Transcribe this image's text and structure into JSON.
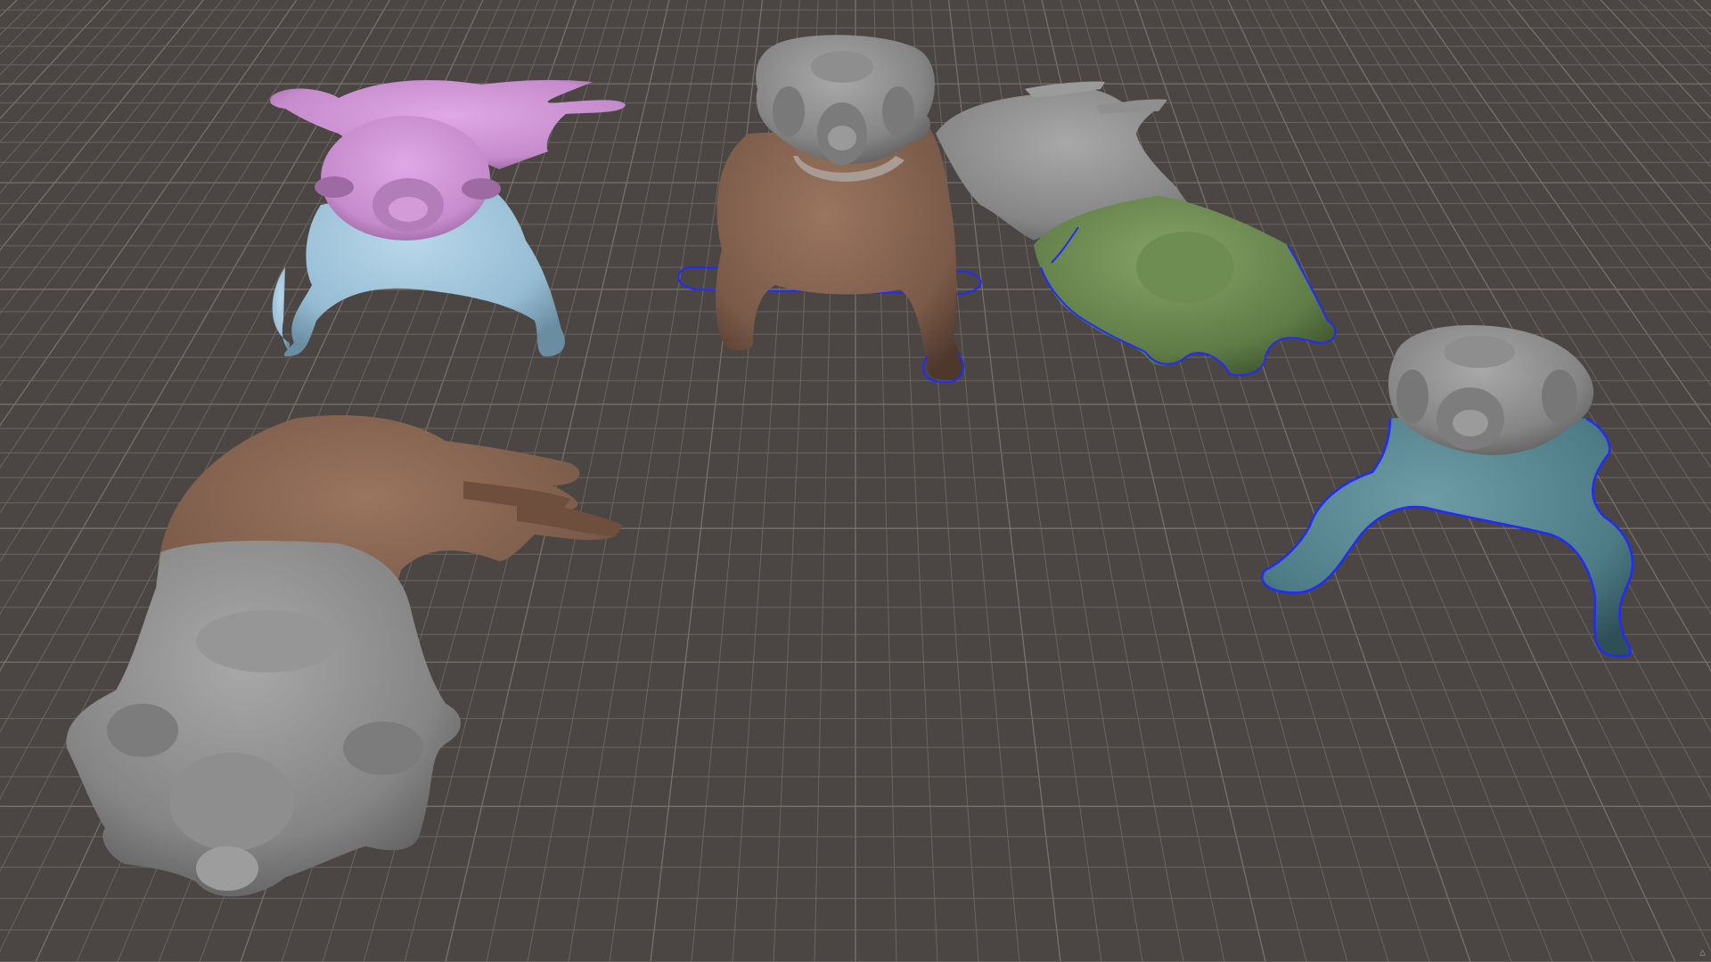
{
  "viewport": {
    "name": "3d-viewport",
    "background": "#4b4643",
    "grid_color": "#6a6561",
    "grid_major_color": "#77716c",
    "selection_outline_color": "#1f2bff",
    "corner_glyph": "▵"
  },
  "models": [
    {
      "id": "dog-pink-blue",
      "head_color": "#c98fcf",
      "body_color": "#9fc3d9",
      "selected": false
    },
    {
      "id": "dog-brown-sitting",
      "head_color": "#8a8a8a",
      "body_color": "#7a5a48",
      "selected": true
    },
    {
      "id": "dog-gray-green-lying",
      "head_color": "#8f8f8f",
      "body_color": "#5e7a45",
      "selected": true
    },
    {
      "id": "dog-gray-brown-lying",
      "head_color": "#8c8c8c",
      "body_color": "#7b5b49",
      "selected": false
    },
    {
      "id": "dog-teal-standing",
      "head_color": "#8a8a8a",
      "body_color": "#4f7f8a",
      "selected": true
    }
  ]
}
